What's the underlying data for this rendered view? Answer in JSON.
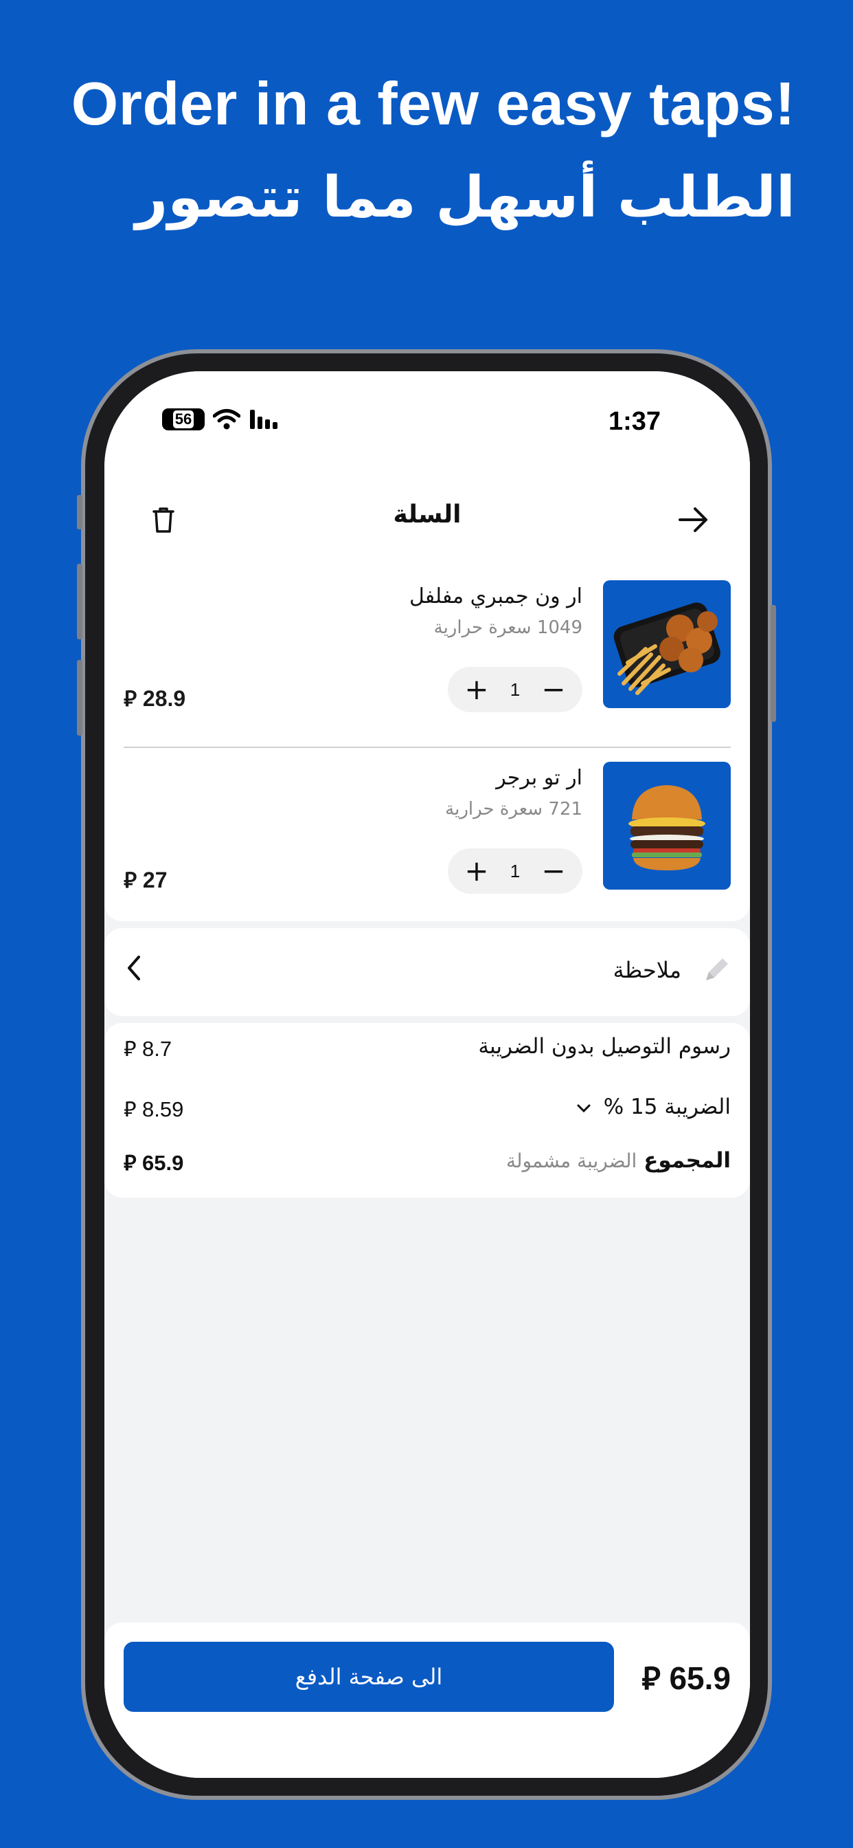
{
  "headline": {
    "en": "Order in a few easy taps!",
    "ar": "الطلب أسهل مما تتصور"
  },
  "status_bar": {
    "time": "1:37",
    "battery": "56"
  },
  "header": {
    "title": "السلة"
  },
  "currency_symbol": "⃁",
  "cart_items": [
    {
      "name": "ار ون جمبري مفلفل",
      "calories": "1049 سعرة حرارية",
      "quantity": "1",
      "price": "28.9"
    },
    {
      "name": "ار تو برجر",
      "calories": "721 سعرة حرارية",
      "quantity": "1",
      "price": "27"
    }
  ],
  "note": {
    "label": "ملاحظة"
  },
  "summary": {
    "delivery_label": "رسوم التوصيل بدون الضريبة",
    "delivery_value": "8.7",
    "tax_label": "الضريبة 15 %",
    "tax_value": "8.59",
    "total_label": "المجموع",
    "total_note": "الضريبة مشمولة",
    "total_value": "65.9"
  },
  "footer": {
    "checkout_label": "الى صفحة الدفع",
    "total": "65.9"
  },
  "colors": {
    "brand": "#0a5ac4",
    "background": "#f2f3f5"
  }
}
